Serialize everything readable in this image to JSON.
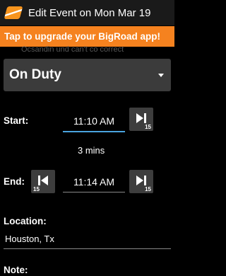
{
  "header": {
    "title": "Edit Event on Mon Mar 19",
    "app_icon": "bigroad-road-icon"
  },
  "banner": {
    "text": "Tap to upgrade your BigRoad app!",
    "color": "#f5821f"
  },
  "ghost_text": "Ocsandin und can't co correct",
  "status": {
    "value": "On Duty"
  },
  "start": {
    "label": "Start:",
    "time": "11:10 AM",
    "forward_step": "15"
  },
  "duration": "3 mins",
  "end": {
    "label": "End:",
    "back_step": "15",
    "time": "11:14 AM",
    "forward_step": "15"
  },
  "location": {
    "label": "Location:",
    "value": "Houston, Tx"
  },
  "note": {
    "label": "Note:"
  },
  "colors": {
    "accent": "#4aa3df",
    "button_bg": "#3d3d3d",
    "select_bg": "#3b3b3b"
  }
}
